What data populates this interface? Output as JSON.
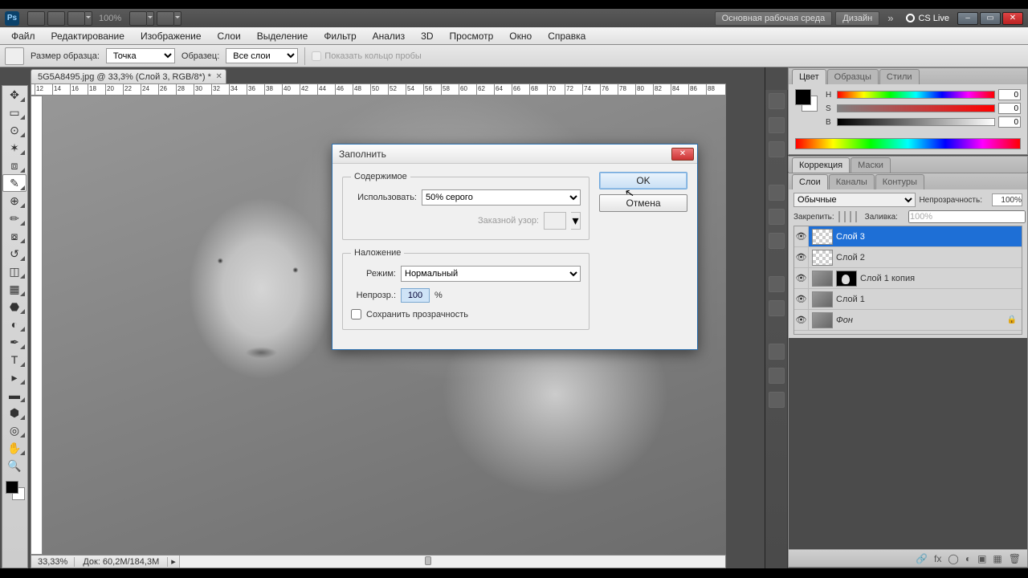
{
  "titlebar": {
    "zoom": "100%",
    "workspace_btn": "Основная рабочая среда",
    "design_btn": "Дизайн",
    "cs_live": "CS Live"
  },
  "menu": [
    "Файл",
    "Редактирование",
    "Изображение",
    "Слои",
    "Выделение",
    "Фильтр",
    "Анализ",
    "3D",
    "Просмотр",
    "Окно",
    "Справка"
  ],
  "options": {
    "sample_label": "Размер образца:",
    "sample_value": "Точка",
    "sample_from_label": "Образец:",
    "sample_from_value": "Все слои",
    "show_ring": "Показать кольцо пробы"
  },
  "doc": {
    "tab": "5G5A8495.jpg @ 33,3% (Слой 3, RGB/8*) *",
    "zoom": "33,33%",
    "info": "Док: 60,2M/184,3M"
  },
  "ruler_ticks": [
    "12",
    "14",
    "16",
    "18",
    "20",
    "22",
    "24",
    "26",
    "28",
    "30",
    "32",
    "34",
    "36",
    "38",
    "40",
    "42",
    "44",
    "46",
    "48",
    "50",
    "52",
    "54",
    "56",
    "58",
    "60",
    "62",
    "64",
    "66",
    "68",
    "70",
    "72",
    "74",
    "76",
    "78",
    "80",
    "82",
    "84",
    "86",
    "88"
  ],
  "dialog": {
    "title": "Заполнить",
    "contents_legend": "Содержимое",
    "use_label": "Использовать:",
    "use_value": "50% серого",
    "pattern_label": "Заказной узор:",
    "blend_legend": "Наложение",
    "mode_label": "Режим:",
    "mode_value": "Нормальный",
    "opacity_label": "Непрозр.:",
    "opacity_value": "100",
    "opacity_unit": "%",
    "preserve": "Сохранить прозрачность",
    "ok": "OK",
    "cancel": "Отмена"
  },
  "panels": {
    "color_tabs": [
      "Цвет",
      "Образцы",
      "Стили"
    ],
    "hsb": {
      "h": "0",
      "s": "0",
      "b": "0"
    },
    "adjust_tabs": [
      "Коррекция",
      "Маски"
    ],
    "layers_tabs": [
      "Слои",
      "Каналы",
      "Контуры"
    ],
    "blend_mode": "Обычные",
    "opacity_label": "Непрозрачность:",
    "opacity": "100%",
    "lock_label": "Закрепить:",
    "fill_label": "Заливка:",
    "fill": "100%",
    "layers": [
      {
        "name": "Слой 3",
        "sel": true,
        "kind": "trans"
      },
      {
        "name": "Слой 2",
        "sel": false,
        "kind": "trans"
      },
      {
        "name": "Слой 1 копия",
        "sel": false,
        "kind": "imgmask"
      },
      {
        "name": "Слой 1",
        "sel": false,
        "kind": "img"
      },
      {
        "name": "Фон",
        "sel": false,
        "kind": "bg"
      }
    ]
  }
}
